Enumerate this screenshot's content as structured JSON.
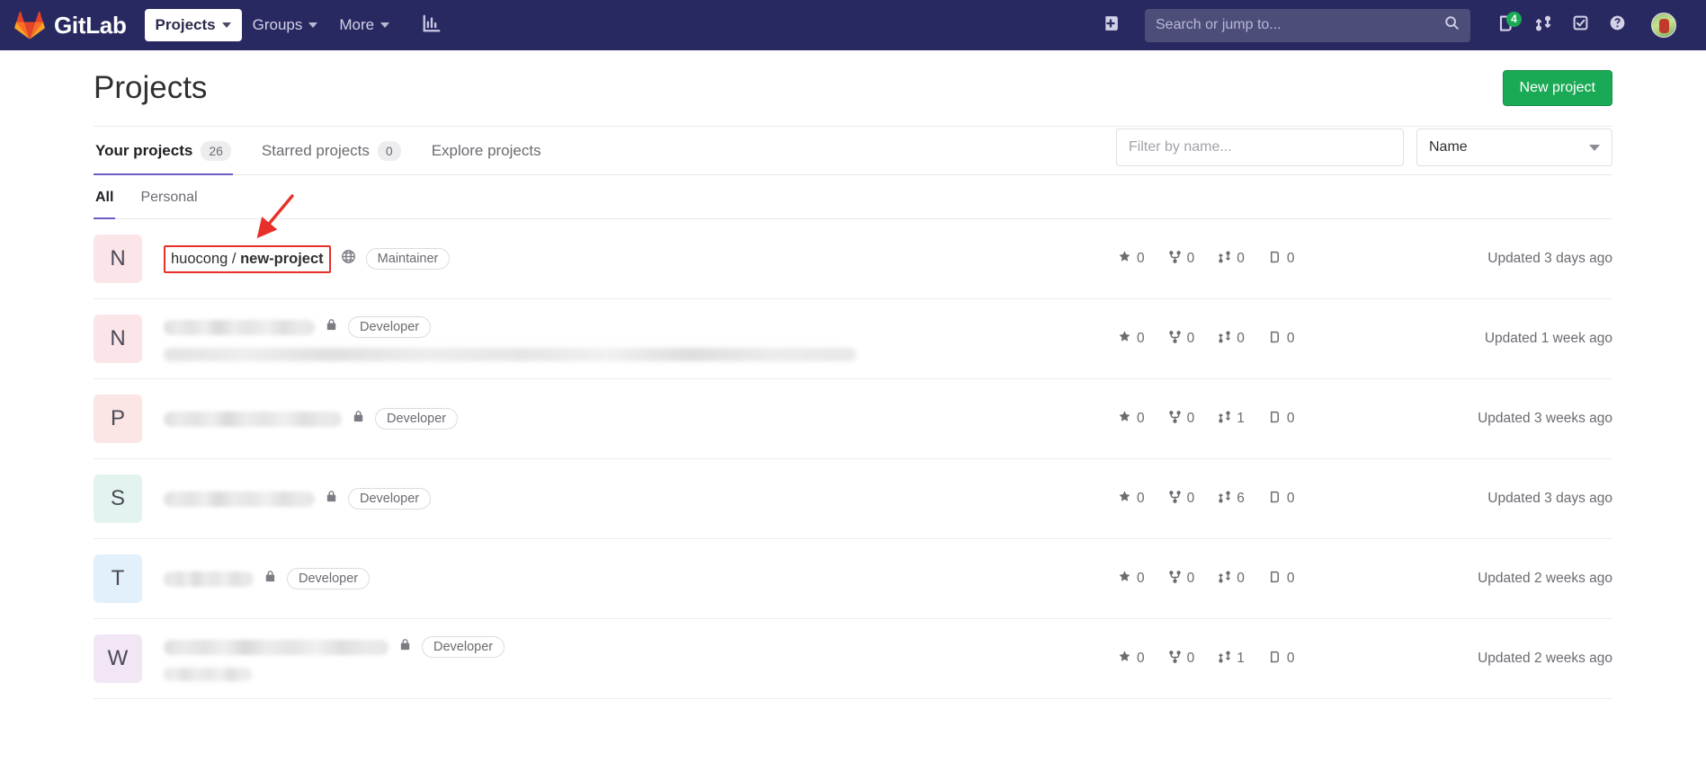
{
  "navbar": {
    "brand": "GitLab",
    "logo_icon": "gitlab-logo-icon",
    "items": [
      {
        "label": "Projects",
        "icon": "chevron-down-icon",
        "active": true
      },
      {
        "label": "Groups",
        "icon": "chevron-down-icon",
        "active": false
      },
      {
        "label": "More",
        "icon": "chevron-down-icon",
        "active": false
      }
    ],
    "analytics_icon": "bar-chart-icon",
    "create_new_icon": "plus-square-icon",
    "search": {
      "placeholder": "Search or jump to...",
      "value": "",
      "icon": "search-icon"
    },
    "issues_icon": "issues-icon",
    "issues_badge": "4",
    "merge_requests_icon": "merge-request-icon",
    "todos_icon": "todo-checkmark-icon",
    "help_icon": "question-circle-icon",
    "avatar_icon": "user-avatar"
  },
  "header": {
    "title": "Projects",
    "new_project_button": "New project"
  },
  "tabs": [
    {
      "label": "Your projects",
      "count": "26",
      "active": true
    },
    {
      "label": "Starred projects",
      "count": "0",
      "active": false
    },
    {
      "label": "Explore projects",
      "count": "",
      "active": false
    }
  ],
  "filter": {
    "placeholder": "Filter by name...",
    "value": "",
    "sort_value": "Name",
    "sort_icon": "chevron-down-icon"
  },
  "subtabs": [
    {
      "label": "All",
      "active": true
    },
    {
      "label": "Personal",
      "active": false
    }
  ],
  "annotation": {
    "color": "#e8302a",
    "target": "huocong / new-project",
    "arrow_icon": "red-arrow-icon"
  },
  "projects": [
    {
      "initial": "N",
      "avatar_color": "#fbe5e8",
      "namespace": "huocong / ",
      "name": "new-project",
      "highlighted": true,
      "visibility_icon": "globe-icon",
      "role": "Maintainer",
      "blurred": false,
      "has_description": false,
      "stars": "0",
      "forks": "0",
      "merge_requests": "0",
      "issues": "0",
      "updated": "Updated 3 days ago"
    },
    {
      "initial": "N",
      "avatar_color": "#fbe5e8",
      "namespace": "",
      "name": "",
      "highlighted": false,
      "visibility_icon": "lock-icon",
      "role": "Developer",
      "blurred": true,
      "has_description": true,
      "title_width": 168,
      "desc_width": 770,
      "stars": "0",
      "forks": "0",
      "merge_requests": "0",
      "issues": "0",
      "updated": "Updated 1 week ago"
    },
    {
      "initial": "P",
      "avatar_color": "#fbe5e5",
      "namespace": "",
      "name": "",
      "highlighted": false,
      "visibility_icon": "lock-icon",
      "role": "Developer",
      "blurred": true,
      "has_description": false,
      "title_width": 198,
      "stars": "0",
      "forks": "0",
      "merge_requests": "1",
      "issues": "0",
      "updated": "Updated 3 weeks ago"
    },
    {
      "initial": "S",
      "avatar_color": "#e3f3ef",
      "namespace": "",
      "name": "",
      "highlighted": false,
      "visibility_icon": "lock-icon",
      "role": "Developer",
      "blurred": true,
      "has_description": false,
      "title_width": 168,
      "stars": "0",
      "forks": "0",
      "merge_requests": "6",
      "issues": "0",
      "updated": "Updated 3 days ago"
    },
    {
      "initial": "T",
      "avatar_color": "#e2f0fb",
      "namespace": "",
      "name": "",
      "highlighted": false,
      "visibility_icon": "lock-icon",
      "role": "Developer",
      "blurred": true,
      "has_description": false,
      "title_width": 100,
      "stars": "0",
      "forks": "0",
      "merge_requests": "0",
      "issues": "0",
      "updated": "Updated 2 weeks ago"
    },
    {
      "initial": "W",
      "avatar_color": "#f2e6f5",
      "namespace": "",
      "name": "",
      "highlighted": false,
      "visibility_icon": "lock-icon",
      "role": "Developer",
      "blurred": true,
      "has_description": true,
      "title_width": 250,
      "desc_width": 98,
      "stars": "0",
      "forks": "0",
      "merge_requests": "1",
      "issues": "0",
      "updated": "Updated 2 weeks ago"
    }
  ]
}
